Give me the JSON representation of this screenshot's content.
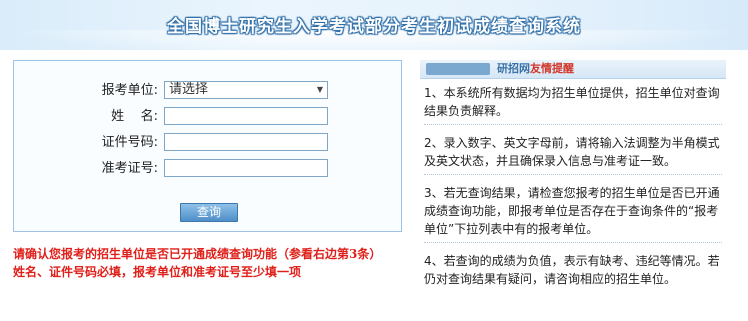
{
  "header": {
    "title": "全国博士研究生入学考试部分考生初试成绩查询系统"
  },
  "form": {
    "unit_label": "报考单位:",
    "unit_selected": "请选择",
    "name_label": "姓    名:",
    "name_value": "",
    "id_label": "证件号码:",
    "id_value": "",
    "ticket_label": "准考证号:",
    "ticket_value": "",
    "submit_label": "查询"
  },
  "warnings": {
    "line1": "请确认您报考的招生单位是否已开通成绩查询功能（参看右边第3条）",
    "line2": "姓名、证件号码必填，报考单位和准考证号至少填一项"
  },
  "tips": {
    "badge": "",
    "title_a": "研招网",
    "title_b": "友情提醒",
    "items": [
      "1、本系统所有数据均为招生单位提供，招生单位对查询结果负责解释。",
      "2、录入数字、英文字母前，请将输入法调整为半角模式及英文状态，并且确保录入信息与准考证一致。",
      "3、若无查询结果，请检查您报考的招生单位是否已开通成绩查询功能，即报考单位是否存在于查询条件的“报考单位”下拉列表中有的报考单位。",
      "4、若查询的成绩为负值，表示有缺考、违纪等情况。若仍对查询结果有疑问，请咨询相应的招生单位。"
    ]
  }
}
